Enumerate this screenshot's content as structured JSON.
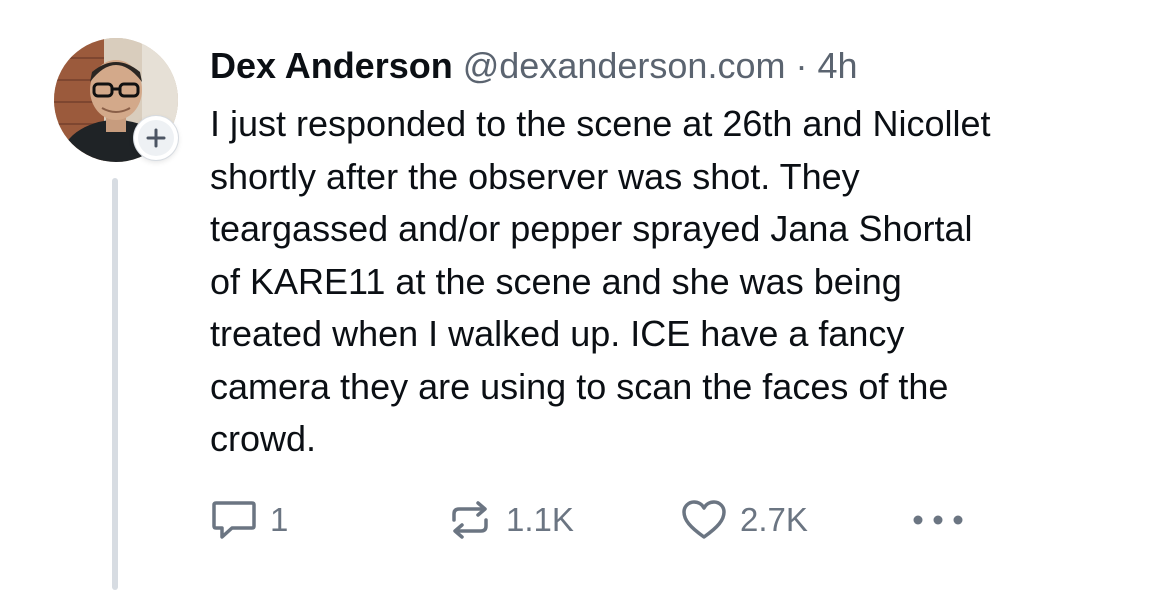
{
  "post": {
    "author": {
      "name": "Dex Anderson",
      "handle": "@dexanderson.com",
      "separator": "·",
      "time": "4h"
    },
    "text_lines": [
      "I just responded to the scene at 26th and Nicollet",
      "shortly after the observer was shot. They",
      "teargassed and/or pepper sprayed Jana Shortal",
      "of KARE11 at the scene and she was being",
      "treated when I walked up. ICE have a fancy",
      "camera they are using to scan the faces of the",
      "crowd."
    ],
    "actions": {
      "reply": {
        "icon": "reply-icon",
        "count": "1"
      },
      "repost": {
        "icon": "repost-icon",
        "count": "1.1K"
      },
      "like": {
        "icon": "heart-icon",
        "count": "2.7K"
      },
      "more": {
        "icon": "more-icon"
      }
    },
    "follow": {
      "icon": "plus-icon"
    }
  },
  "colors": {
    "text": "#0b0f14",
    "muted": "#5b6470",
    "icon": "#6b7582",
    "thread_line": "#d7dce2"
  }
}
